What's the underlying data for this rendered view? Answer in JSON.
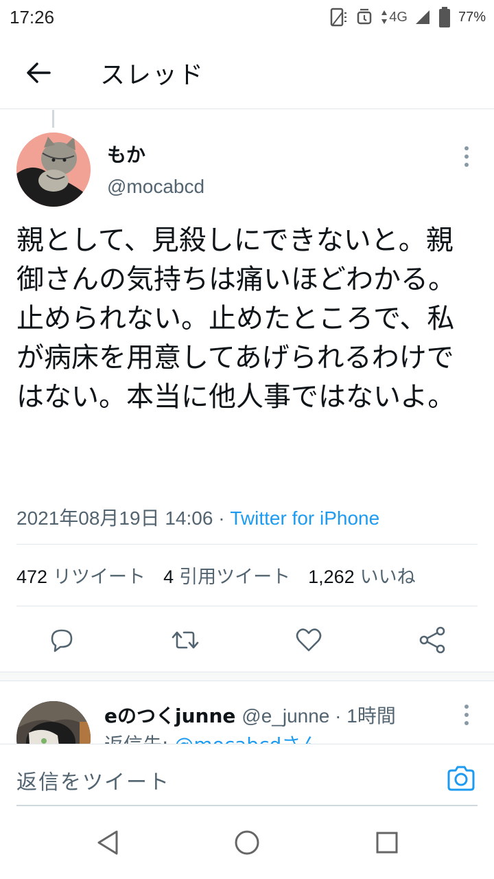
{
  "status_bar": {
    "time": "17:26",
    "network": "4G",
    "battery": "77%"
  },
  "header": {
    "title": "スレッド",
    "back_icon": "arrow-left-icon"
  },
  "tweet": {
    "name": "もか",
    "handle": "@mocabcd",
    "text": "親として、見殺しにできないと。親御さんの気持ちは痛いほどわかる。止められない。止めたところで、私が病床を用意してあげられるわけではない。本当に他人事ではないよ。",
    "date": "2021年08月19日 14:06",
    "separator": " · ",
    "source": "Twitter for iPhone",
    "stats": [
      {
        "count": "472",
        "label": "リツイート"
      },
      {
        "count": "4",
        "label": "引用ツイート"
      },
      {
        "count": "1,262",
        "label": "いいね"
      }
    ]
  },
  "reply": {
    "name": "eのつくjunne",
    "handle": "@e_junne",
    "time": " · 1時間",
    "reply_to_prefix": "返信先: ",
    "reply_to": "@mocabcdさん"
  },
  "composer": {
    "placeholder": "返信をツイート"
  },
  "colors": {
    "accent": "#1d9bf0",
    "text": "#0f1419",
    "secondary": "#536471",
    "border": "#e1e8ed"
  }
}
